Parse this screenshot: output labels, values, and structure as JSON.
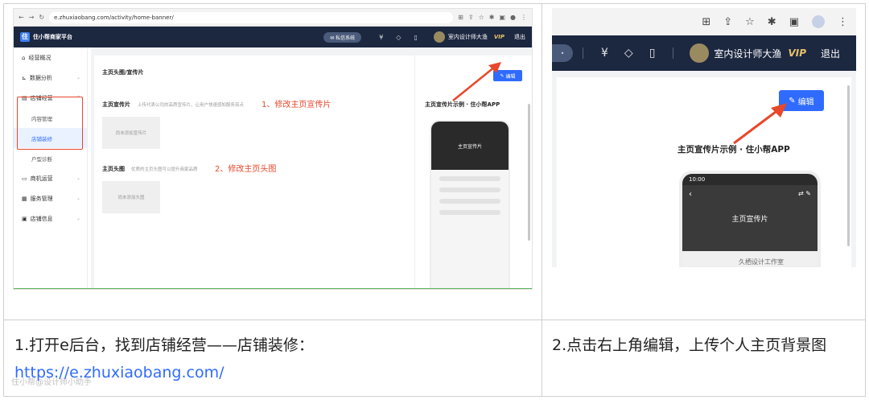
{
  "left_shot": {
    "browser": {
      "url": "e.zhuxiaobang.com/activity/home-banner/"
    },
    "app": {
      "logo": "住小帮商家平台",
      "message_button": "私信系统",
      "message_badge": "",
      "user_name": "室内设计师大渔",
      "vip": "VIP",
      "logout": "退出"
    },
    "sidebar": {
      "items": [
        {
          "label": "经营概况"
        },
        {
          "label": "数据分析"
        },
        {
          "label": "店铺经营"
        },
        {
          "label": "商机运营"
        },
        {
          "label": "服务管理"
        },
        {
          "label": "店铺信息"
        }
      ],
      "subitems": [
        {
          "label": "内容管理"
        },
        {
          "label": "店铺装修"
        },
        {
          "label": "户型诊断"
        }
      ]
    },
    "panel": {
      "title": "主页头图/宣传片",
      "row1_label": "主页宣传片",
      "row1_desc": "上传代表公司的高质宣传片，让用户快速感知服务亮点",
      "row1_placeholder": "尚未添加宣传片",
      "row2_label": "主页头图",
      "row2_desc": "优质的主页头图可以提升商家品质",
      "row2_placeholder": "尚未添加头图",
      "note1": "1、修改主页宣传片",
      "note2": "2、修改主页头图"
    },
    "preview": {
      "edit_button": "编辑",
      "title": "主页宣传片示例 · 住小帮APP",
      "phone_hero": "主页宣传片"
    }
  },
  "right_shot": {
    "app": {
      "user_name": "室内设计师大渔",
      "vip": "VIP",
      "logout": "退出"
    },
    "edit_button": "编辑",
    "title": "主页宣传片示例 · 住小帮APP",
    "phone": {
      "time": "10:00",
      "hero": "主页宣传片",
      "studio": "久栖设计工作室"
    }
  },
  "captions": {
    "left_text": "1.打开e后台，找到店铺经营——店铺装修：",
    "left_link": "https://e.zhuxiaobang.com/",
    "right_text": "2.点击右上角编辑，上传个人主页背景图"
  },
  "watermark": "住小帮@设计师小助手",
  "colors": {
    "accent": "#2f6bff",
    "nav_dark": "#1c2740",
    "annotation_red": "#e8472b",
    "vip_gold": "#e8c26a"
  }
}
